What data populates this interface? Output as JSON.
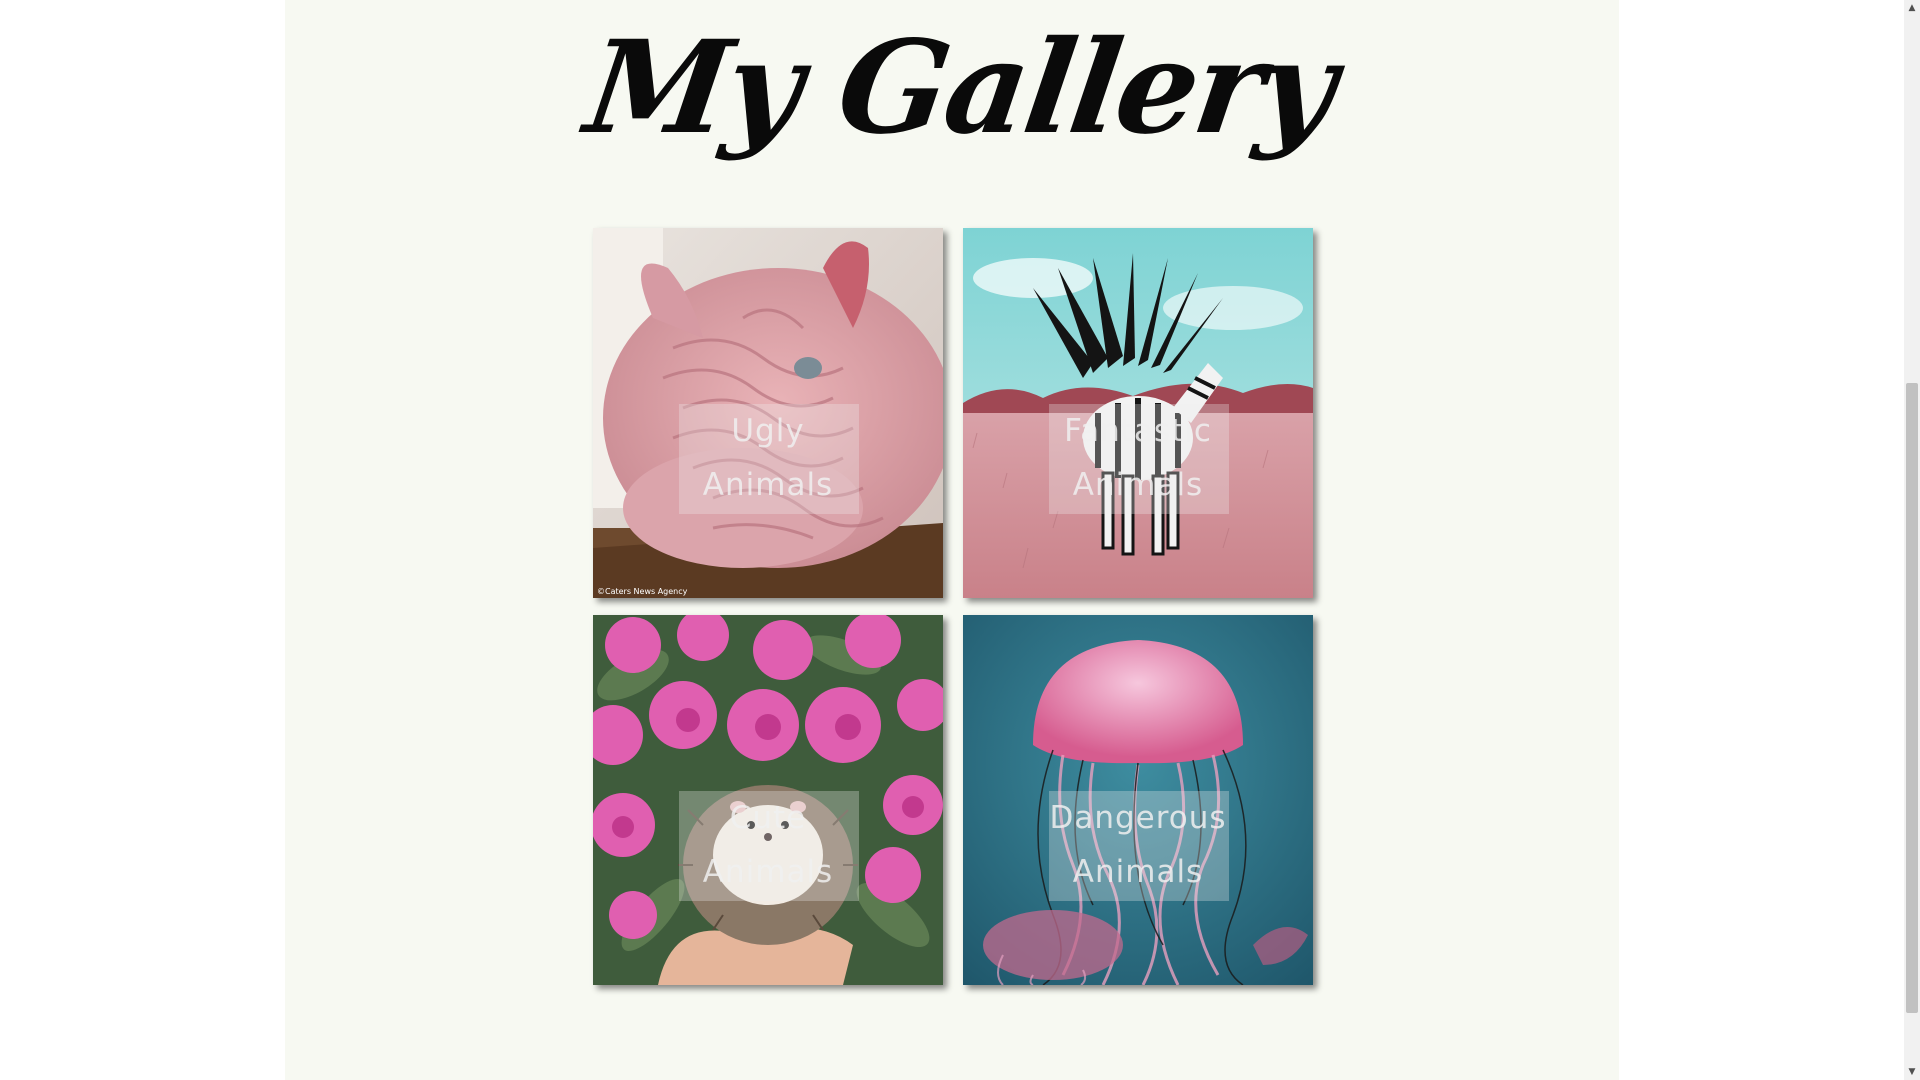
{
  "page": {
    "title": "My Gallery"
  },
  "gallery": {
    "tiles": [
      {
        "id": "ugly",
        "line1": "Ugly",
        "line2": "Animals",
        "watermark": "©Caters News Agency"
      },
      {
        "id": "fantastic",
        "line1": "Fantastic",
        "line2": "Animals"
      },
      {
        "id": "cute",
        "line1": "Cute",
        "line2": "Animals"
      },
      {
        "id": "dangerous",
        "line1": "Dangerous",
        "line2": "Animals"
      }
    ]
  },
  "colors": {
    "strip_background": "#f7f9f2",
    "title_color": "#0a0a0a",
    "caption_color": "#f0f0f0"
  },
  "scrollbar": {
    "up_icon": "chevron-up-icon",
    "down_icon": "chevron-down-icon"
  }
}
